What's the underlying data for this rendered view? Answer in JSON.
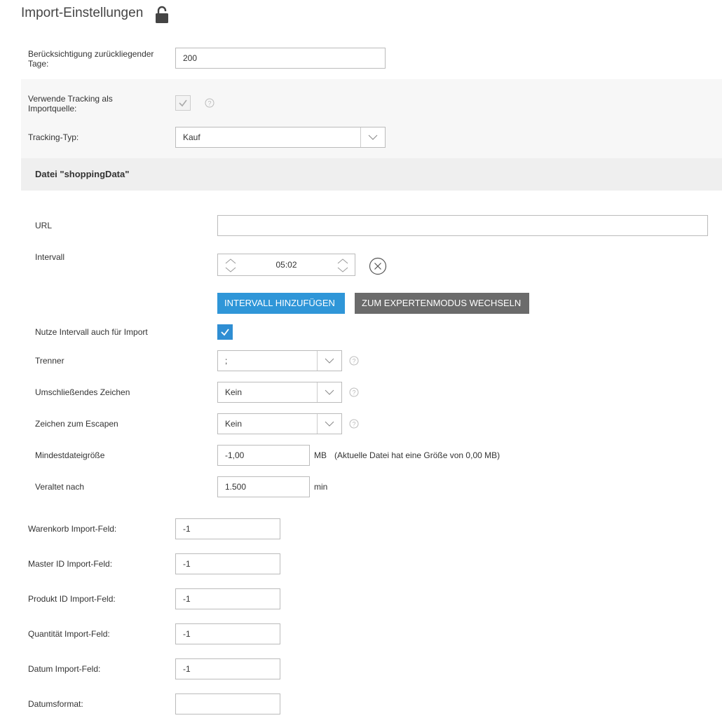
{
  "page": {
    "title": "Import-Einstellungen"
  },
  "general": {
    "days_label": "Berücksichtigung zurückliegender Tage:",
    "days_value": "200",
    "use_tracking_label": "Verwende Tracking als Importquelle:",
    "use_tracking_checked": true,
    "tracking_type_label": "Tracking-Typ:",
    "tracking_type_value": "Kauf"
  },
  "file": {
    "section_title": "Datei \"shoppingData\"",
    "url_label": "URL",
    "url_value": "",
    "interval_label": "Intervall",
    "interval_value": "05:02",
    "add_interval_button": "INTERVALL HINZUFÜGEN",
    "expert_mode_button": "ZUM EXPERTENMODUS WECHSELN",
    "use_interval_label": "Nutze Intervall auch für Import",
    "use_interval_checked": true,
    "separator_label": "Trenner",
    "separator_value": ";",
    "enclosure_label": "Umschließendes Zeichen",
    "enclosure_value": "Kein",
    "escape_label": "Zeichen zum Escapen",
    "escape_value": "Kein",
    "min_size_label": "Mindestdateigröße",
    "min_size_value": "-1,00",
    "min_size_unit": "MB",
    "min_size_note": "(Aktuelle Datei hat eine Größe von 0,00 MB)",
    "outdated_label": "Veraltet nach",
    "outdated_value": "1.500",
    "outdated_unit": "min"
  },
  "fields": {
    "cart_label": "Warenkorb Import-Feld:",
    "cart_value": "-1",
    "master_label": "Master ID Import-Feld:",
    "master_value": "-1",
    "product_label": "Produkt ID Import-Feld:",
    "product_value": "-1",
    "quantity_label": "Quantität Import-Feld:",
    "quantity_value": "-1",
    "date_label": "Datum Import-Feld:",
    "date_value": "-1",
    "date_format_label": "Datumsformat:",
    "date_format_value": ""
  },
  "icons": {
    "lock": "unlocked-padlock-icon",
    "help": "question-circle-icon",
    "dropdown": "chevron-down-icon",
    "spinner": "chevron-up-down-icon",
    "remove": "close-circle-icon",
    "check": "check-icon"
  },
  "colors": {
    "primary": "#2f96d8",
    "secondary": "#6b6b6b"
  }
}
